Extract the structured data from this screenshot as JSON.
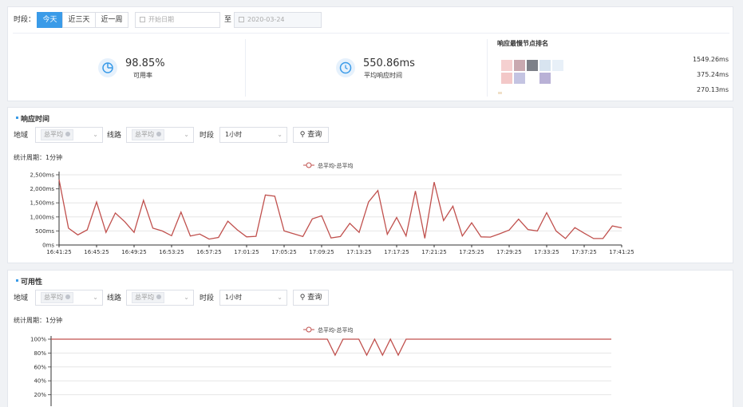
{
  "filter": {
    "period_label": "时段：",
    "ranges": [
      "今天",
      "近三天",
      "近一周"
    ],
    "start_placeholder": "开始日期",
    "to_label": "至",
    "end_date": "2020-03-24"
  },
  "stats": {
    "availability": {
      "value": "98.85%",
      "label": "可用率"
    },
    "avg_response": {
      "value": "550.86ms",
      "label": "平均响应时间"
    },
    "ranking": {
      "title": "响应最慢节点排名",
      "values": [
        "1549.26ms",
        "375.24ms",
        "270.13ms"
      ]
    }
  },
  "response_section": {
    "title": "响应时间",
    "region_label": "地域",
    "region_tag": "总平均",
    "line_label": "线路",
    "line_tag": "总平均",
    "period_label": "时段",
    "period_value": "1小时",
    "query_label": "查询",
    "cycle": "统计周期：1分钟"
  },
  "availability_section": {
    "title": "可用性",
    "region_label": "地域",
    "region_tag": "总平均",
    "line_label": "线路",
    "line_tag": "总平均",
    "period_label": "时段",
    "period_value": "1小时",
    "query_label": "查询",
    "cycle": "统计周期：1分钟"
  },
  "colors": {
    "accent": "#3a9be8",
    "series": "#c0504d"
  },
  "chart_data": [
    {
      "type": "line",
      "legend": "总平均-总平均",
      "ylim": [
        0,
        2500
      ],
      "yticks": [
        "0ms",
        "500ms",
        "1,000ms",
        "1,500ms",
        "2,000ms",
        "2,500ms"
      ],
      "xticks": [
        "16:41:25",
        "16:45:25",
        "16:49:25",
        "16:53:25",
        "16:57:25",
        "17:01:25",
        "17:05:25",
        "17:09:25",
        "17:13:25",
        "17:17:25",
        "17:21:25",
        "17:25:25",
        "17:29:25",
        "17:33:25",
        "17:37:25",
        "17:41:25"
      ],
      "series": [
        {
          "name": "总平均-总平均",
          "values": [
            2330,
            600,
            360,
            540,
            1530,
            450,
            1140,
            830,
            450,
            1590,
            600,
            500,
            330,
            1170,
            320,
            390,
            210,
            270,
            850,
            540,
            290,
            310,
            1780,
            1740,
            500,
            400,
            300,
            930,
            1040,
            250,
            300,
            770,
            450,
            1530,
            1940,
            380,
            980,
            320,
            1920,
            240,
            2240,
            870,
            1380,
            320,
            790,
            290,
            280,
            400,
            530,
            920,
            550,
            500,
            1150,
            500,
            230,
            620,
            420,
            230,
            230,
            680,
            610
          ]
        }
      ]
    },
    {
      "type": "line",
      "legend": "总平均-总平均",
      "ylim": [
        0,
        100
      ],
      "yticks": [
        "20%",
        "40%",
        "60%",
        "80%",
        "100%"
      ],
      "series": [
        {
          "name": "总平均-总平均",
          "values": [
            100,
            100,
            100,
            100,
            100,
            100,
            100,
            100,
            100,
            100,
            100,
            100,
            100,
            100,
            100,
            100,
            100,
            100,
            100,
            100,
            100,
            100,
            100,
            100,
            100,
            100,
            100,
            100,
            100,
            100,
            100,
            100,
            100,
            100,
            100,
            100,
            77,
            100,
            100,
            100,
            77,
            100,
            77,
            100,
            77,
            100,
            100,
            100,
            100,
            100,
            100,
            100,
            100,
            100,
            100,
            100,
            100,
            100,
            100,
            100,
            100,
            100,
            100,
            100,
            100,
            100,
            100,
            100,
            100,
            100,
            100,
            100
          ]
        }
      ]
    }
  ]
}
